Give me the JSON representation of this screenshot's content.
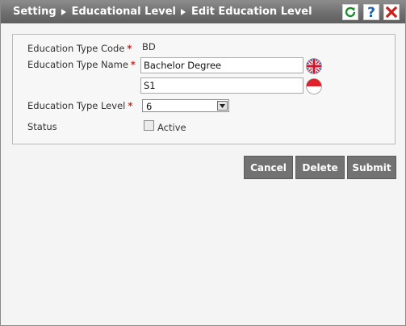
{
  "breadcrumb": [
    "Setting",
    "Educational Level",
    "Edit Education Level"
  ],
  "toolbar": {
    "refresh_icon": "refresh-icon",
    "help_icon": "help-icon",
    "close_icon": "close-icon"
  },
  "form": {
    "code_label": "Education Type Code",
    "code_value": "BD",
    "name_label": "Education Type Name",
    "name_value_en": "Bachelor Degree",
    "name_value_id": "S1",
    "level_label": "Education Type Level",
    "level_value": "6",
    "status_label": "Status",
    "status_option": "Active",
    "required_mark": "*"
  },
  "buttons": {
    "cancel": "Cancel",
    "delete": "Delete",
    "submit": "Submit"
  },
  "colors": {
    "titlebar": "#6e6e6e",
    "button": "#727272",
    "required": "#d9201b",
    "refresh": "#1f8a2c",
    "help": "#1e5fb4",
    "close": "#c8231c"
  }
}
